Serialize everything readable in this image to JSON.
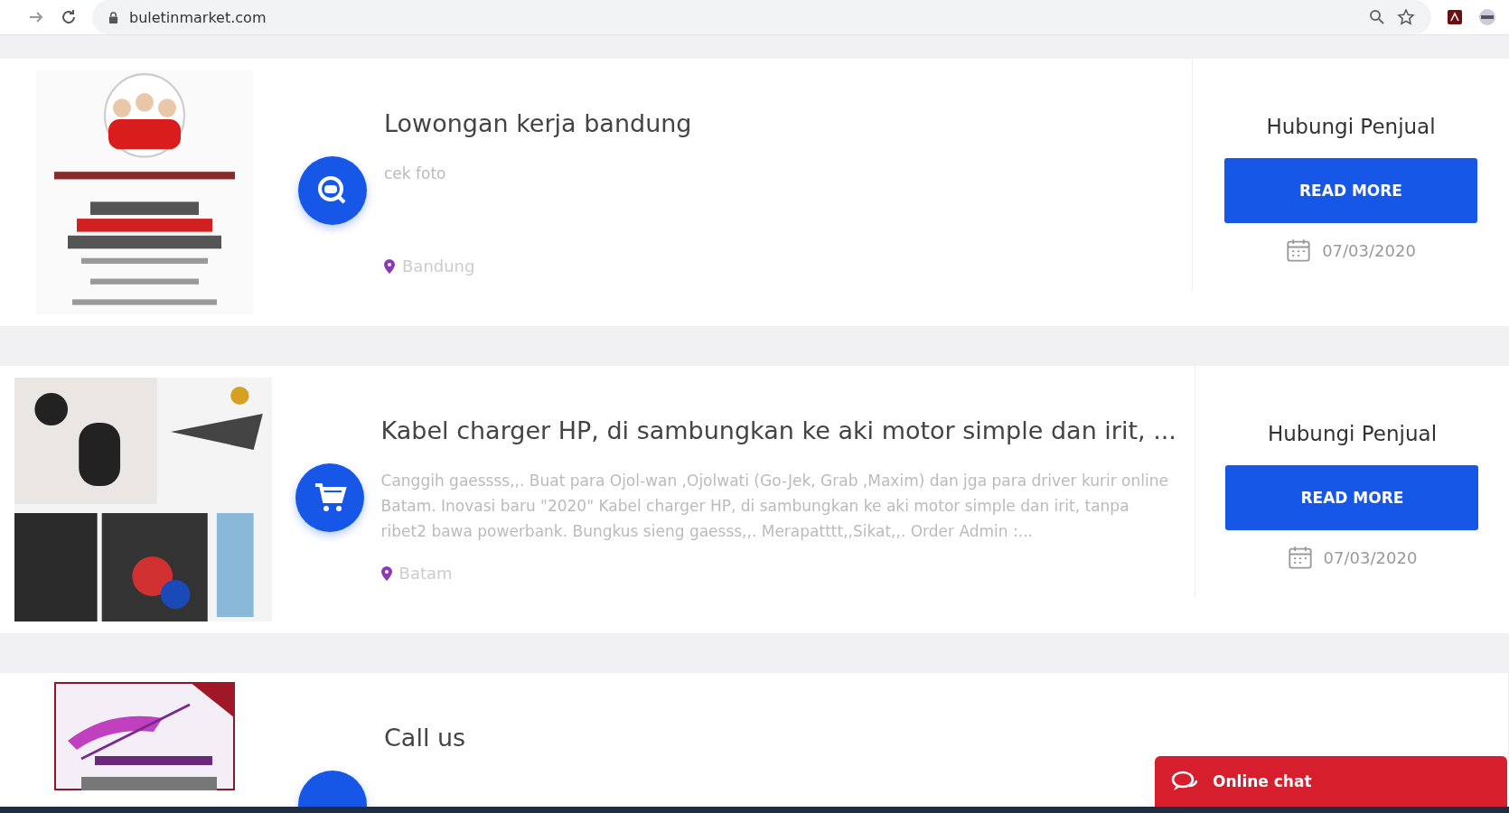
{
  "browser": {
    "url": "buletinmarket.com"
  },
  "listings": [
    {
      "title": "Lowongan kerja bandung",
      "description": "cek foto",
      "location": "Bandung",
      "kind": "job",
      "seller_label": "Hubungi Penjual",
      "button": "READ MORE",
      "date": "07/03/2020"
    },
    {
      "title": "Kabel charger HP, di sambungkan ke aki motor simple dan irit, ...",
      "description": "Canggih gaessss,,. Buat para Ojol-wan ,Ojolwati (Go-Jek, Grab ,Maxim) dan jga para driver kurir online Batam. Inovasi baru \"2020\" Kabel charger HP, di sambungkan ke aki motor simple dan irit, tanpa ribet2 bawa powerbank. Bungkus sieng gaesss,,. Merapatttt,,Sikat,,. Order Admin :...",
      "location": "Batam",
      "kind": "product",
      "seller_label": "Hubungi Penjual",
      "button": "READ MORE",
      "date": "07/03/2020"
    },
    {
      "title": "Call us",
      "kind": "contact"
    }
  ],
  "chat": {
    "label": "Online chat"
  }
}
